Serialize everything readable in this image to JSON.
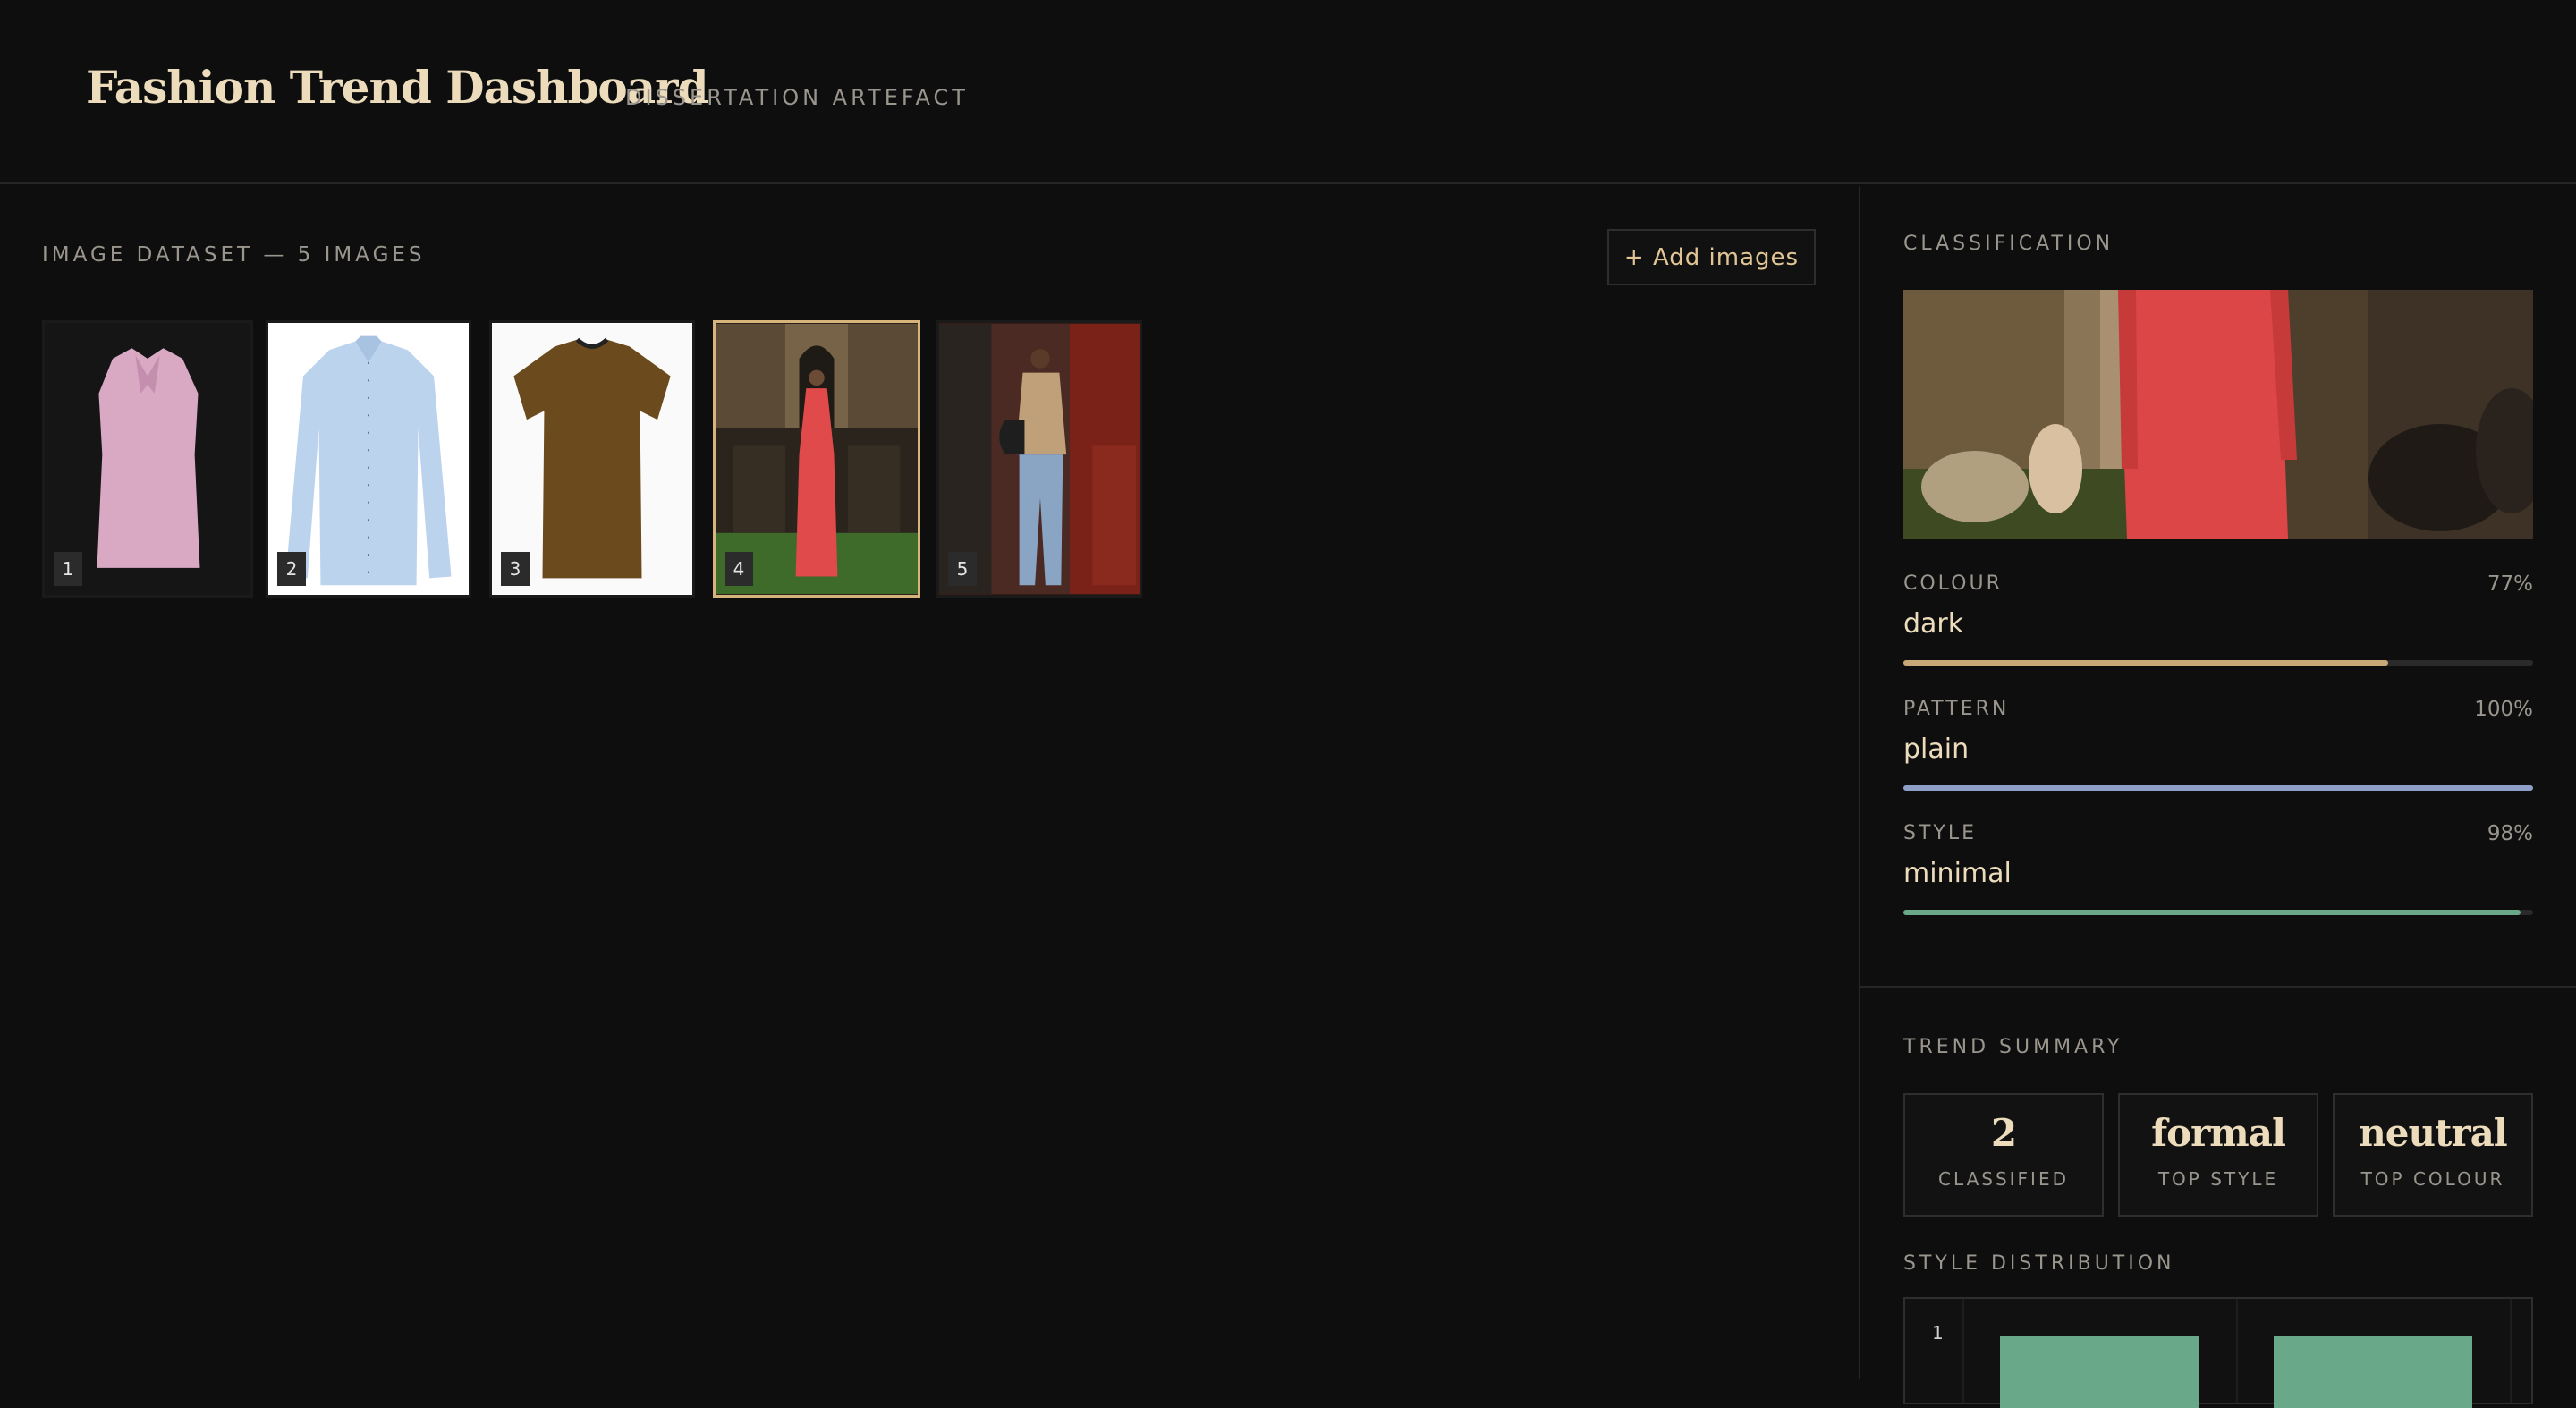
{
  "header": {
    "title": "Fashion Trend Dashboard",
    "subtitle": "DISSERTATION ARTEFACT"
  },
  "dataset": {
    "heading": "IMAGE DATASET — 5 IMAGES",
    "add_button": "+ Add images",
    "images": [
      {
        "number": "1",
        "item": "pink sleeveless blouse"
      },
      {
        "number": "2",
        "item": "light blue shirt"
      },
      {
        "number": "3",
        "item": "brown t-shirt"
      },
      {
        "number": "4",
        "item": "red runway dress",
        "selected": true
      },
      {
        "number": "5",
        "item": "runway sweater and jeans"
      }
    ]
  },
  "classification": {
    "heading": "CLASSIFICATION",
    "metrics": [
      {
        "label": "COLOUR",
        "value": "dark",
        "percent": "77%",
        "fraction": 0.77,
        "color": "#c9a878"
      },
      {
        "label": "PATTERN",
        "value": "plain",
        "percent": "100%",
        "fraction": 1.0,
        "color": "#8ea0c8"
      },
      {
        "label": "STYLE",
        "value": "minimal",
        "percent": "98%",
        "fraction": 0.98,
        "color": "#6aa88a"
      }
    ]
  },
  "trend_summary": {
    "heading": "TREND SUMMARY",
    "cards": [
      {
        "value": "2",
        "label": "CLASSIFIED"
      },
      {
        "value": "formal",
        "label": "TOP STYLE"
      },
      {
        "value": "neutral",
        "label": "TOP COLOUR"
      }
    ]
  },
  "style_distribution": {
    "heading": "STYLE DISTRIBUTION",
    "tick": "1"
  },
  "colors": {
    "accent": "#d6b47c",
    "background": "#0e0e0e",
    "bar": "#6aa88a"
  }
}
